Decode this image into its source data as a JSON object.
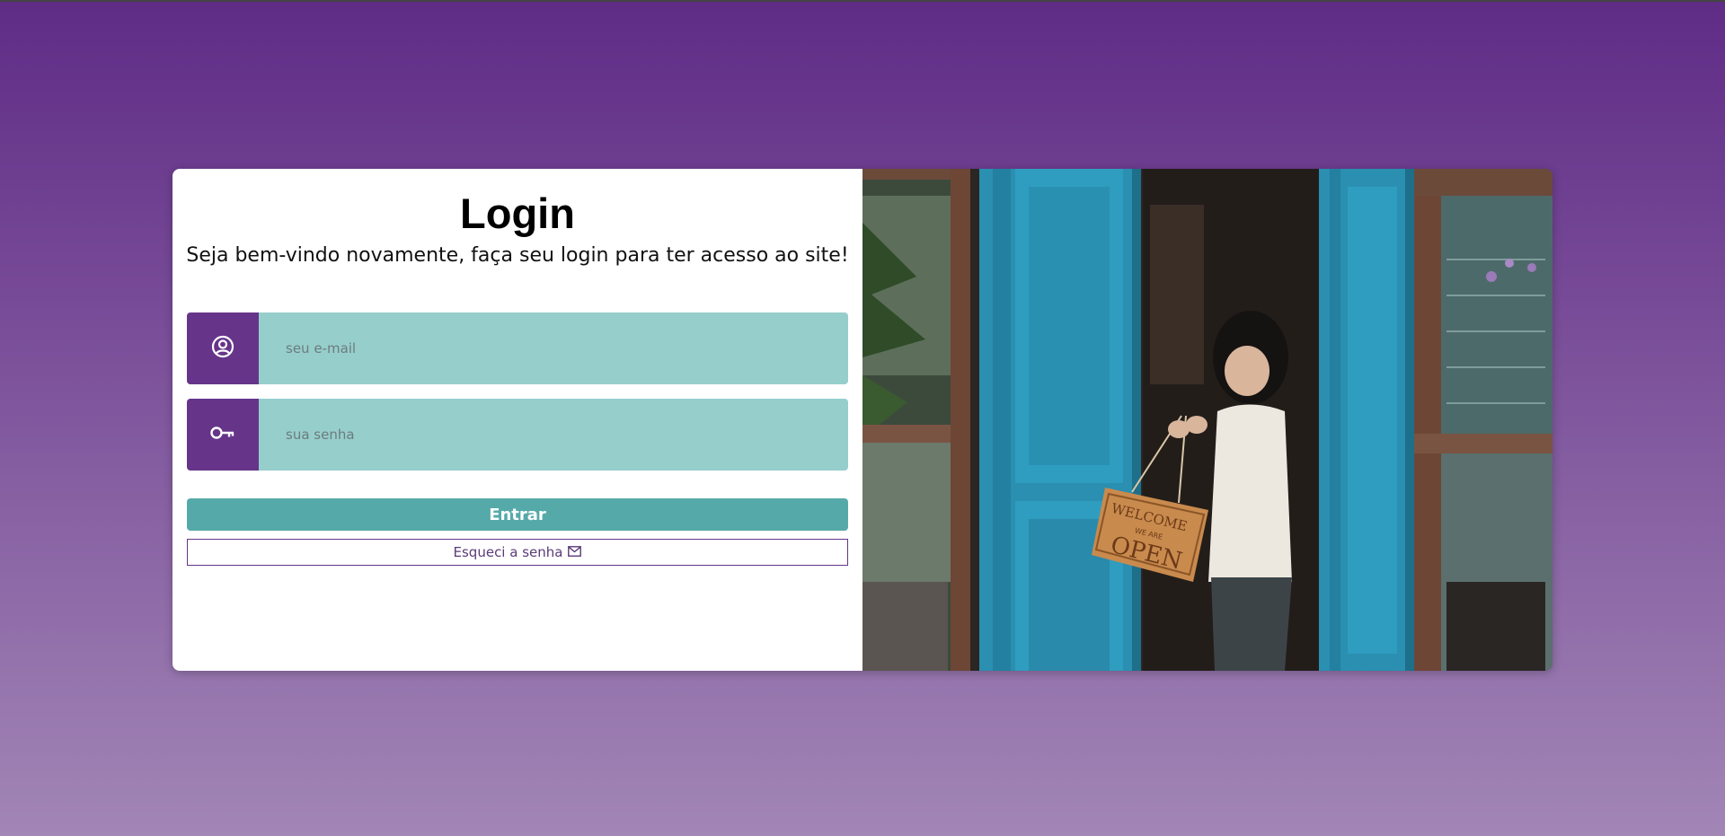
{
  "login": {
    "title": "Login",
    "subtitle": "Seja bem-vindo novamente, faça seu login para ter acesso ao site!",
    "email_placeholder": "seu e-mail",
    "password_placeholder": "sua senha",
    "submit_label": "Entrar",
    "forgot_label": "Esqueci a senha"
  },
  "icons": {
    "email": "user-circle-icon",
    "password": "key-icon",
    "forgot": "envelope-icon"
  },
  "sign": {
    "line1": "WELCOME",
    "line2": "WE ARE",
    "line3": "OPEN"
  },
  "colors": {
    "background_top": "#5f2c86",
    "background_bottom": "#a286b6",
    "icon_panel": "#66358a",
    "input_bg": "#96cecc",
    "submit_bg": "#55aaa9",
    "forgot_border": "#66358a"
  }
}
